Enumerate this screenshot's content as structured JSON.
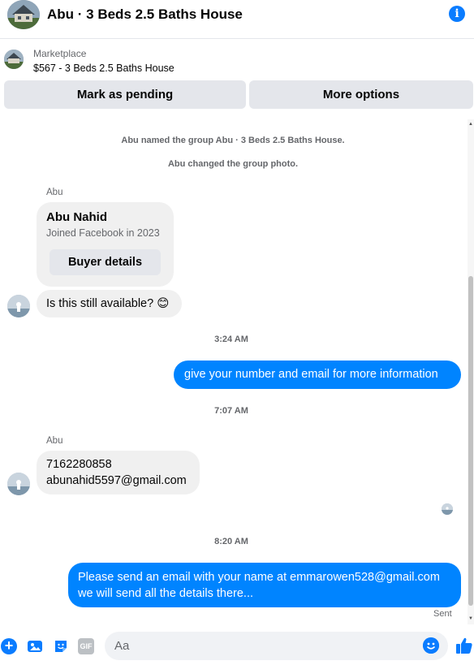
{
  "header": {
    "title": "Abu · 3 Beds 2.5 Baths House",
    "info_icon": "info-icon",
    "info_glyph": "i"
  },
  "marketplace": {
    "label": "Marketplace",
    "item": "$567 - 3 Beds 2.5 Baths House",
    "buttons": {
      "pending": "Mark as pending",
      "more": "More options"
    }
  },
  "chat": {
    "system": [
      "Abu named the group Abu · 3 Beds 2.5 Baths House.",
      "Abu changed the group photo."
    ],
    "sender_name": "Abu",
    "profile_card": {
      "name": "Abu Nahid",
      "joined": "Joined Facebook in 2023",
      "button": "Buyer details"
    },
    "first_message": "Is this still available? 😊",
    "time_1": "3:24 AM",
    "out_1": "give your number and email for more information",
    "time_2": "7:07 AM",
    "reply_phone": "7162280858",
    "reply_email": "abunahid5597@gmail.com",
    "time_3": "8:20 AM",
    "out_2_line1": "Please send an email with your name at emmarowen528@gmail.com",
    "out_2_line2": "we will send all the details there...",
    "status": "Sent"
  },
  "composer": {
    "placeholder": "Aa",
    "gif_label": "GIF",
    "plus_glyph": "+",
    "icons": [
      "plus-icon",
      "photo-icon",
      "sticker-icon",
      "gif-icon",
      "emoji-icon",
      "like-icon"
    ]
  },
  "colors": {
    "accent": "#0084ff",
    "bubble_in": "#f0f0f0",
    "button_bg": "#e4e6eb"
  }
}
